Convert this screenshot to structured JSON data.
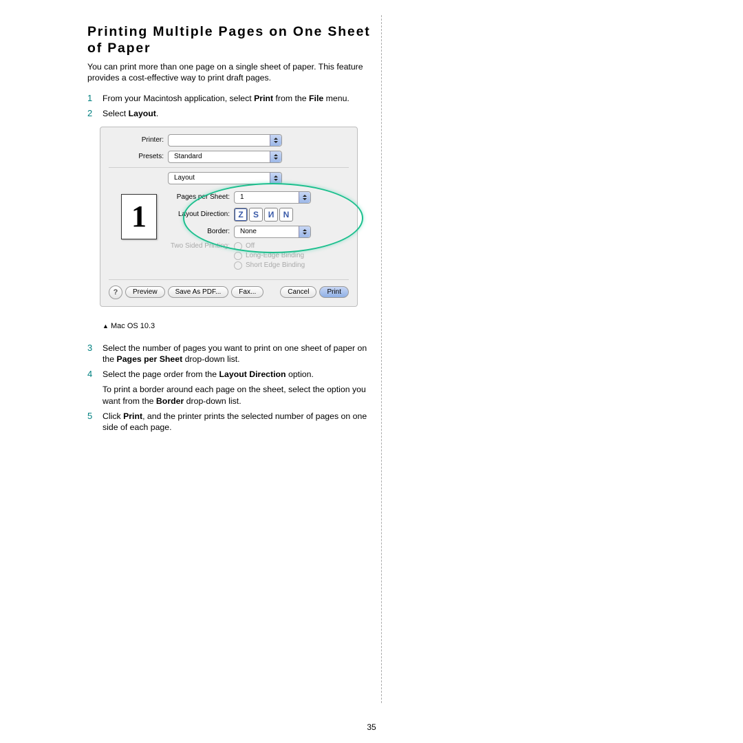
{
  "title_line1": "Printing Multiple Pages on One Sheet",
  "title_line2": "of Paper",
  "intro": "You can print more than one page on a single sheet of paper. This feature provides a cost-effective way to print draft pages.",
  "steps_top": [
    {
      "n": "1",
      "parts": [
        "From your Macintosh application, select ",
        {
          "b": "Print"
        },
        " from the ",
        {
          "b": "File"
        },
        " menu."
      ]
    },
    {
      "n": "2",
      "parts": [
        "Select ",
        {
          "b": "Layout"
        },
        "."
      ]
    }
  ],
  "dialog": {
    "printer_label": "Printer:",
    "printer_value": "",
    "presets_label": "Presets:",
    "presets_value": "Standard",
    "panel_value": "Layout",
    "pps_label": "Pages per Sheet:",
    "pps_value": "1",
    "ld_label": "Layout Direction:",
    "border_label": "Border:",
    "border_value": "None",
    "tws_label": "Two Sided Printing:",
    "tws_off": "Off",
    "tws_long": "Long-Edge Binding",
    "tws_short": "Short Edge Binding",
    "preview_digit": "1",
    "btn_help": "?",
    "btn_preview": "Preview",
    "btn_savepdf": "Save As PDF...",
    "btn_fax": "Fax...",
    "btn_cancel": "Cancel",
    "btn_print": "Print",
    "layout_icons": [
      "Z",
      "S",
      "И",
      "N"
    ]
  },
  "caption_marker": "▲",
  "caption_text": "Mac OS 10.3",
  "steps_bottom": [
    {
      "n": "3",
      "parts": [
        "Select the number of pages you want to print on one sheet of paper on the ",
        {
          "b": "Pages per Sheet"
        },
        " drop-down list."
      ]
    },
    {
      "n": "4",
      "parts": [
        "Select the page order from the ",
        {
          "b": "Layout Direction"
        },
        " option."
      ],
      "extra": [
        "To print a border around each page on the sheet, select the option you want from the ",
        {
          "b": "Border"
        },
        " drop-down list."
      ]
    },
    {
      "n": "5",
      "parts": [
        "Click ",
        {
          "b": "Print"
        },
        ", and the printer prints the selected number of pages on one side of each page."
      ]
    }
  ],
  "page_number": "35"
}
